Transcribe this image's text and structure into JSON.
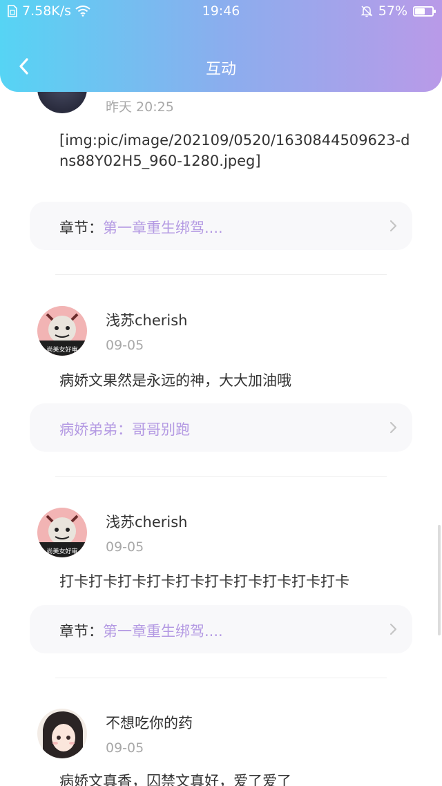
{
  "status_bar": {
    "network_speed": "7.58K/s",
    "time": "19:46",
    "battery_percent": "57%",
    "battery_level": 0.57
  },
  "header": {
    "title": "互动",
    "back_icon": "chevron-left-icon"
  },
  "comments": [
    {
      "date": "昨天 20:25",
      "content": "[img:pic/image/202109/0520/1630844509623-dns88Y02H5_960-1280.jpeg]",
      "chapter_prefix": "章节：",
      "chapter_title": "第一章重生绑驾...."
    },
    {
      "username": "浅苏cherish",
      "date": "09-05",
      "content": "病娇文果然是永远的神，大大加油哦",
      "book_title": "病娇弟弟：哥哥别跑"
    },
    {
      "username": "浅苏cherish",
      "date": "09-05",
      "content": "打卡打卡打卡打卡打卡打卡打卡打卡打卡打卡",
      "chapter_prefix": "章节：",
      "chapter_title": "第一章重生绑驾...."
    },
    {
      "username": "不想吃你的药",
      "date": "09-05",
      "content": "病娇文真香，囚禁文真好，爱了爱了"
    }
  ],
  "colors": {
    "accent_purple": "#b49ae3",
    "header_gradient_start": "#56d4f4",
    "header_gradient_end": "#b99ae8"
  }
}
